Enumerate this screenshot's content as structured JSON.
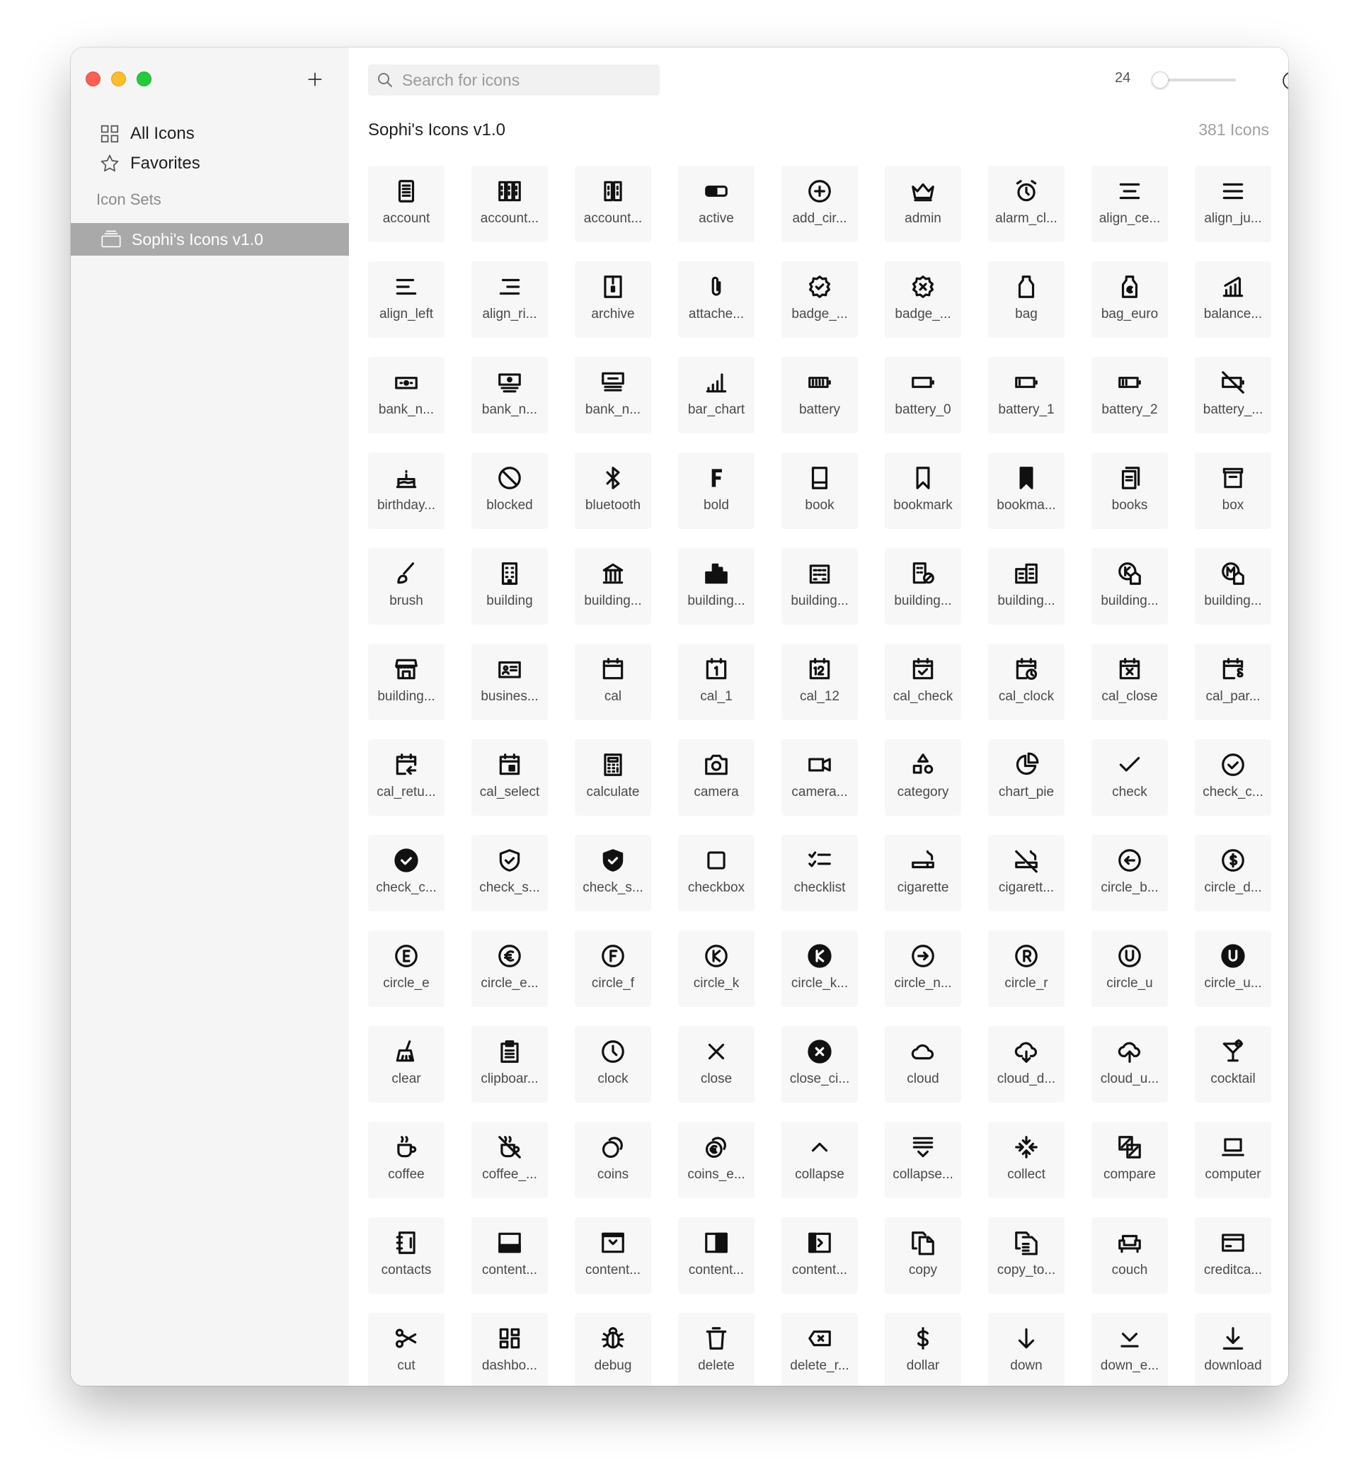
{
  "sidebar": {
    "nav": [
      {
        "label": "All Icons",
        "icon": "grid-icon"
      },
      {
        "label": "Favorites",
        "icon": "star-icon"
      }
    ],
    "section_label": "Icon Sets",
    "sets": [
      {
        "label": "Sophi's Icons v1.0",
        "icon": "tray-icon",
        "selected": true
      }
    ]
  },
  "toolbar": {
    "search_placeholder": "Search for icons",
    "size_value": "24",
    "size_slider_fraction": 0.0
  },
  "content": {
    "title": "Sophi's Icons v1.0",
    "count": "381 Icons",
    "icons": [
      {
        "label": "account",
        "icon": "doc"
      },
      {
        "label": "account...",
        "icon": "doc2"
      },
      {
        "label": "account...",
        "icon": "doc3"
      },
      {
        "label": "active",
        "icon": "toggle"
      },
      {
        "label": "add_cir...",
        "icon": "pluscircle"
      },
      {
        "label": "admin",
        "icon": "crown"
      },
      {
        "label": "alarm_cl...",
        "icon": "alarm"
      },
      {
        "label": "align_ce...",
        "icon": "aligncenter"
      },
      {
        "label": "align_ju...",
        "icon": "alignjust"
      },
      {
        "label": "align_left",
        "icon": "alignleft"
      },
      {
        "label": "align_ri...",
        "icon": "alignright"
      },
      {
        "label": "archive",
        "icon": "archive"
      },
      {
        "label": "attache...",
        "icon": "clip"
      },
      {
        "label": "badge_...",
        "icon": "badgecheck"
      },
      {
        "label": "badge_...",
        "icon": "badgex"
      },
      {
        "label": "bag",
        "icon": "bag"
      },
      {
        "label": "bag_euro",
        "icon": "bageuro"
      },
      {
        "label": "balance...",
        "icon": "balance"
      },
      {
        "label": "bank_n...",
        "icon": "note"
      },
      {
        "label": "bank_n...",
        "icon": "note2"
      },
      {
        "label": "bank_n...",
        "icon": "note3"
      },
      {
        "label": "bar_chart",
        "icon": "barchart"
      },
      {
        "label": "battery",
        "icon": "batfull"
      },
      {
        "label": "battery_0",
        "icon": "bat0"
      },
      {
        "label": "battery_1",
        "icon": "bat1"
      },
      {
        "label": "battery_2",
        "icon": "bat2"
      },
      {
        "label": "battery_...",
        "icon": "batoff"
      },
      {
        "label": "birthday...",
        "icon": "cake"
      },
      {
        "label": "blocked",
        "icon": "blocked"
      },
      {
        "label": "bluetooth",
        "icon": "bluetooth"
      },
      {
        "label": "bold",
        "icon": "bold"
      },
      {
        "label": "book",
        "icon": "book"
      },
      {
        "label": "bookmark",
        "icon": "bookmark"
      },
      {
        "label": "bookma...",
        "icon": "bookmarkfill"
      },
      {
        "label": "books",
        "icon": "books"
      },
      {
        "label": "box",
        "icon": "box"
      },
      {
        "label": "brush",
        "icon": "brush"
      },
      {
        "label": "building",
        "icon": "building"
      },
      {
        "label": "building...",
        "icon": "bank"
      },
      {
        "label": "building...",
        "icon": "city"
      },
      {
        "label": "building...",
        "icon": "office"
      },
      {
        "label": "building...",
        "icon": "buildingoff"
      },
      {
        "label": "building...",
        "icon": "buildings"
      },
      {
        "label": "building...",
        "icon": "buildingk"
      },
      {
        "label": "building...",
        "icon": "buildingm"
      },
      {
        "label": "building...",
        "icon": "store"
      },
      {
        "label": "busines...",
        "icon": "card"
      },
      {
        "label": "cal",
        "icon": "cal"
      },
      {
        "label": "cal_1",
        "icon": "cal1"
      },
      {
        "label": "cal_12",
        "icon": "cal12"
      },
      {
        "label": "cal_check",
        "icon": "calcheck"
      },
      {
        "label": "cal_clock",
        "icon": "calclock"
      },
      {
        "label": "cal_close",
        "icon": "calclose"
      },
      {
        "label": "cal_par...",
        "icon": "calpar"
      },
      {
        "label": "cal_retu...",
        "icon": "calreturn"
      },
      {
        "label": "cal_select",
        "icon": "calselect"
      },
      {
        "label": "calculate",
        "icon": "calculator"
      },
      {
        "label": "camera",
        "icon": "camera"
      },
      {
        "label": "camera...",
        "icon": "video"
      },
      {
        "label": "category",
        "icon": "category"
      },
      {
        "label": "chart_pie",
        "icon": "pie"
      },
      {
        "label": "check",
        "icon": "check"
      },
      {
        "label": "check_c...",
        "icon": "checkcircle"
      },
      {
        "label": "check_c...",
        "icon": "checkcirclefill"
      },
      {
        "label": "check_s...",
        "icon": "shieldcheck"
      },
      {
        "label": "check_s...",
        "icon": "shieldfill"
      },
      {
        "label": "checkbox",
        "icon": "checkbox"
      },
      {
        "label": "checklist",
        "icon": "checklist"
      },
      {
        "label": "cigarette",
        "icon": "cigarette"
      },
      {
        "label": "cigarett...",
        "icon": "cigaretteoff"
      },
      {
        "label": "circle_b...",
        "icon": "circleback"
      },
      {
        "label": "circle_d...",
        "icon": "circledollar"
      },
      {
        "label": "circle_e",
        "icon": "circlee"
      },
      {
        "label": "circle_e...",
        "icon": "circleeuro"
      },
      {
        "label": "circle_f",
        "icon": "circlef"
      },
      {
        "label": "circle_k",
        "icon": "circlek"
      },
      {
        "label": "circle_k...",
        "icon": "circlekfill"
      },
      {
        "label": "circle_n...",
        "icon": "circlenext"
      },
      {
        "label": "circle_r",
        "icon": "circler"
      },
      {
        "label": "circle_u",
        "icon": "circleu"
      },
      {
        "label": "circle_u...",
        "icon": "circleufill"
      },
      {
        "label": "clear",
        "icon": "clear"
      },
      {
        "label": "clipboar...",
        "icon": "clipboard"
      },
      {
        "label": "clock",
        "icon": "clock"
      },
      {
        "label": "close",
        "icon": "close"
      },
      {
        "label": "close_ci...",
        "icon": "closecircle"
      },
      {
        "label": "cloud",
        "icon": "cloud"
      },
      {
        "label": "cloud_d...",
        "icon": "clouddown"
      },
      {
        "label": "cloud_u...",
        "icon": "cloudup"
      },
      {
        "label": "cocktail",
        "icon": "cocktail"
      },
      {
        "label": "coffee",
        "icon": "coffee"
      },
      {
        "label": "coffee_...",
        "icon": "coffeeoff"
      },
      {
        "label": "coins",
        "icon": "coins"
      },
      {
        "label": "coins_e...",
        "icon": "coinseuro"
      },
      {
        "label": "collapse",
        "icon": "chevronup"
      },
      {
        "label": "collapse...",
        "icon": "collapseall"
      },
      {
        "label": "collect",
        "icon": "collect"
      },
      {
        "label": "compare",
        "icon": "compare"
      },
      {
        "label": "computer",
        "icon": "laptop"
      },
      {
        "label": "contacts",
        "icon": "contacts"
      },
      {
        "label": "content...",
        "icon": "panelbottom"
      },
      {
        "label": "content...",
        "icon": "paneltop"
      },
      {
        "label": "content...",
        "icon": "panelright"
      },
      {
        "label": "content...",
        "icon": "panelleft"
      },
      {
        "label": "copy",
        "icon": "copy"
      },
      {
        "label": "copy_to...",
        "icon": "copyto"
      },
      {
        "label": "couch",
        "icon": "couch"
      },
      {
        "label": "creditca...",
        "icon": "creditcard"
      },
      {
        "label": "cut",
        "icon": "scissors"
      },
      {
        "label": "dashbo...",
        "icon": "dashboard"
      },
      {
        "label": "debug",
        "icon": "bug"
      },
      {
        "label": "delete",
        "icon": "trash"
      },
      {
        "label": "delete_r...",
        "icon": "deleteleft"
      },
      {
        "label": "dollar",
        "icon": "dollar"
      },
      {
        "label": "down",
        "icon": "arrowdown"
      },
      {
        "label": "down_e...",
        "icon": "downend"
      },
      {
        "label": "download",
        "icon": "download"
      }
    ]
  }
}
